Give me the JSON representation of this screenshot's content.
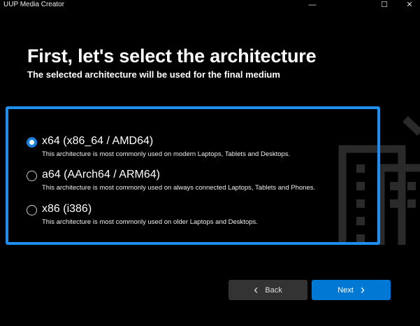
{
  "window": {
    "title": "UUP Media Creator",
    "minimize": "—",
    "maximize": "☐",
    "close": "✕"
  },
  "header": {
    "title": "First, let's select the architecture",
    "subtitle": "The selected architecture will be used for the final medium"
  },
  "options": [
    {
      "label": "x64 (x86_64 / AMD64)",
      "description": "This architecture is most commonly used on modern Laptops, Tablets and Desktops.",
      "selected": true
    },
    {
      "label": "a64 (AArch64 / ARM64)",
      "description": "This architecture is most commonly used on always connected Laptops, Tablets and Phones.",
      "selected": false
    },
    {
      "label": "x86 (i386)",
      "description": "This architecture is most commonly used on older Laptops and Desktops.",
      "selected": false
    }
  ],
  "buttons": {
    "back": "Back",
    "back_icon": "‹",
    "next": "Next",
    "next_icon": "›"
  },
  "colors": {
    "accent": "#0078d4",
    "border": "#1e8fef",
    "icon": "#2a2a2a"
  }
}
